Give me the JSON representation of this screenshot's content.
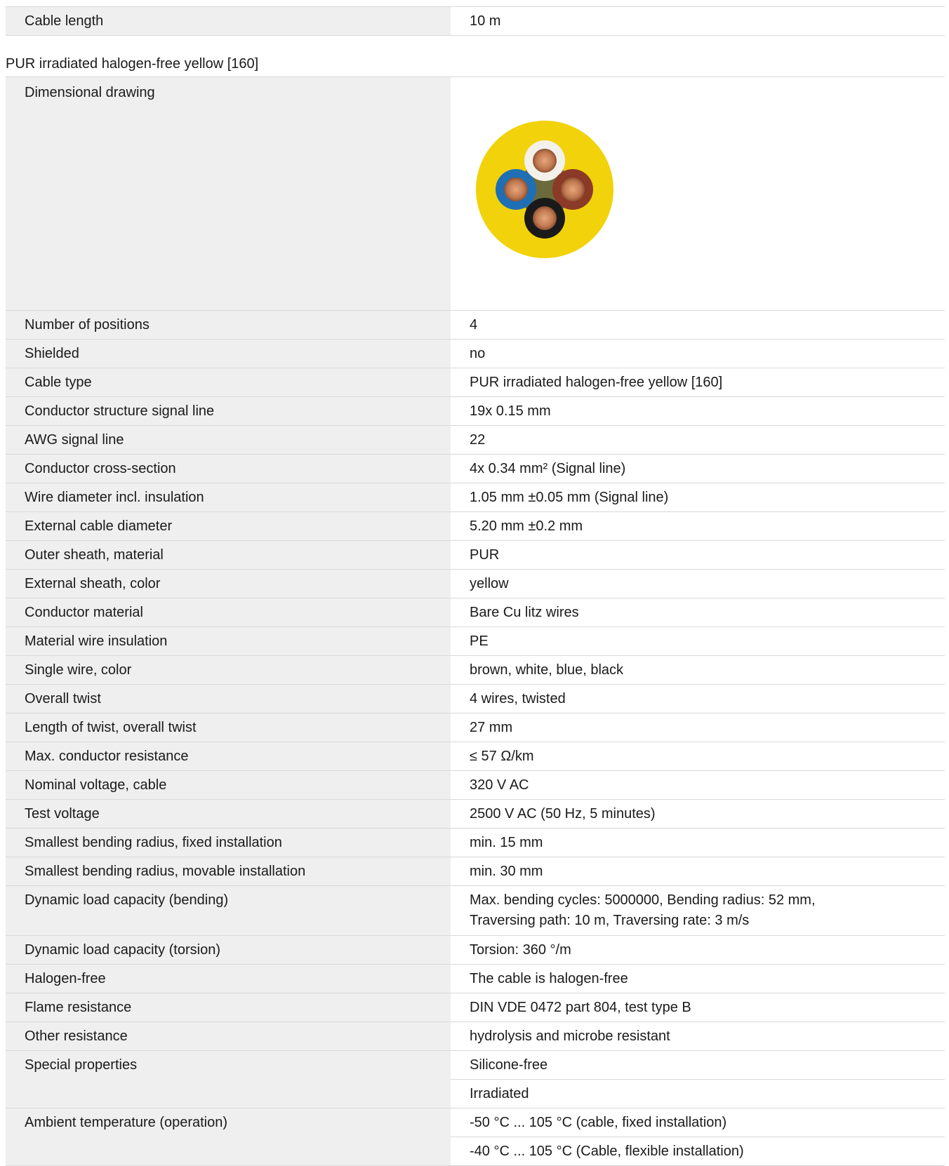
{
  "top_row": {
    "label": "Cable length",
    "value": "10 m"
  },
  "section_title": "PUR irradiated halogen-free yellow [160]",
  "drawing": {
    "label": "Dimensional drawing",
    "colors": {
      "sheath": "#f2d20a",
      "white": "#f4f1ea",
      "brown": "#8b3a27",
      "blue": "#1f6fb4",
      "black": "#1a1a1a",
      "copper": "#c8835a",
      "filler": "#6b6a3a"
    }
  },
  "rows": [
    {
      "label": "Number of positions",
      "value": "4"
    },
    {
      "label": "Shielded",
      "value": "no"
    },
    {
      "label": "Cable type",
      "value": "PUR irradiated halogen-free yellow [160]"
    },
    {
      "label": "Conductor structure signal line",
      "value": "19x 0.15 mm"
    },
    {
      "label": "AWG signal line",
      "value": "22"
    },
    {
      "label": "Conductor cross-section",
      "value": "4x 0.34 mm² (Signal line)"
    },
    {
      "label": "Wire diameter incl. insulation",
      "value": "1.05 mm ±0.05 mm (Signal line)"
    },
    {
      "label": "External cable diameter",
      "value": "5.20 mm ±0.2 mm"
    },
    {
      "label": "Outer sheath, material",
      "value": "PUR"
    },
    {
      "label": "External sheath, color",
      "value": "yellow"
    },
    {
      "label": "Conductor material",
      "value": "Bare Cu litz wires"
    },
    {
      "label": "Material wire insulation",
      "value": "PE"
    },
    {
      "label": "Single wire, color",
      "value": "brown, white, blue, black"
    },
    {
      "label": "Overall twist",
      "value": "4 wires, twisted"
    },
    {
      "label": "Length of twist, overall twist",
      "value": "27 mm"
    },
    {
      "label": "Max. conductor resistance",
      "value": "≤ 57 Ω/km"
    },
    {
      "label": "Nominal voltage, cable",
      "value": "320 V AC"
    },
    {
      "label": "Test voltage",
      "value": "2500 V AC (50 Hz, 5 minutes)"
    },
    {
      "label": "Smallest bending radius, fixed installation",
      "value": "min. 15 mm"
    },
    {
      "label": "Smallest bending radius, movable installation",
      "value": "min. 30 mm"
    }
  ],
  "bending": {
    "label": "Dynamic load capacity (bending)",
    "line1": "Max. bending cycles: 5000000, Bending radius: 52 mm,",
    "line2": "Traversing path: 10 m, Traversing rate: 3 m/s"
  },
  "rows2": [
    {
      "label": "Dynamic load capacity (torsion)",
      "value": "Torsion: 360 °/m"
    },
    {
      "label": "Halogen-free",
      "value": "The cable is halogen-free"
    },
    {
      "label": "Flame resistance",
      "value": "DIN VDE 0472 part 804, test type B"
    },
    {
      "label": "Other resistance",
      "value": "hydrolysis and microbe resistant"
    }
  ],
  "special": {
    "label": "Special properties",
    "values": [
      "Silicone-free",
      "Irradiated"
    ]
  },
  "ambient": {
    "label": "Ambient temperature (operation)",
    "values": [
      "-50 °C ... 105 °C (cable, fixed installation)",
      "-40 °C ... 105 °C (Cable, flexible installation)"
    ]
  }
}
